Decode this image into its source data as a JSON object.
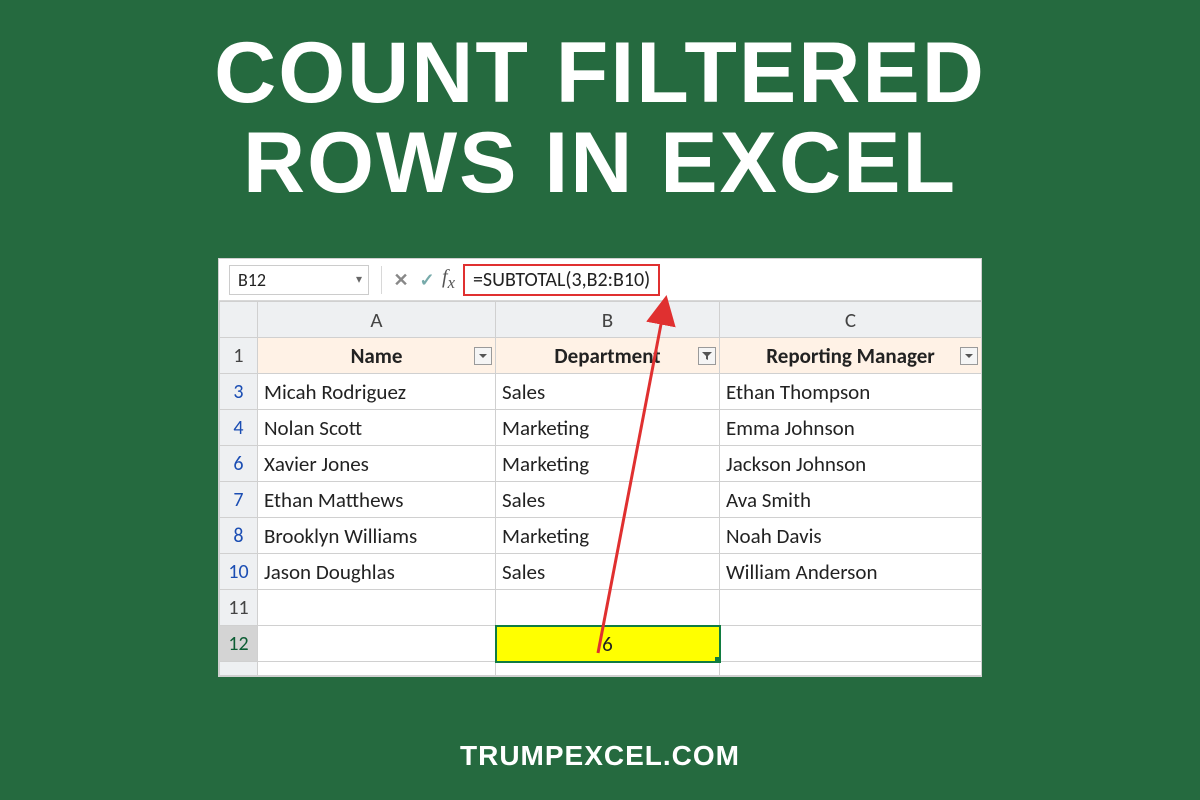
{
  "title_line1": "COUNT FILTERED",
  "title_line2": "ROWS IN EXCEL",
  "footer": "TRUMPEXCEL.COM",
  "namebox_value": "B12",
  "formula": "=SUBTOTAL(3,B2:B10)",
  "col_headers": [
    "A",
    "B",
    "C"
  ],
  "data_headers": {
    "a": "Name",
    "b": "Department",
    "c": "Reporting Manager"
  },
  "rows": [
    {
      "n": "3",
      "a": "Micah Rodriguez",
      "b": "Sales",
      "c": "Ethan Thompson"
    },
    {
      "n": "4",
      "a": "Nolan Scott",
      "b": "Marketing",
      "c": "Emma Johnson"
    },
    {
      "n": "6",
      "a": "Xavier Jones",
      "b": "Marketing",
      "c": "Jackson Johnson"
    },
    {
      "n": "7",
      "a": "Ethan Matthews",
      "b": "Sales",
      "c": "Ava Smith"
    },
    {
      "n": "8",
      "a": "Brooklyn Williams",
      "b": "Marketing",
      "c": "Noah Davis"
    },
    {
      "n": "10",
      "a": "Jason Doughlas",
      "b": "Sales",
      "c": "William Anderson"
    }
  ],
  "blank_row_num": "11",
  "result_row_num": "12",
  "result_value": "6",
  "data_header_row_num": "1"
}
